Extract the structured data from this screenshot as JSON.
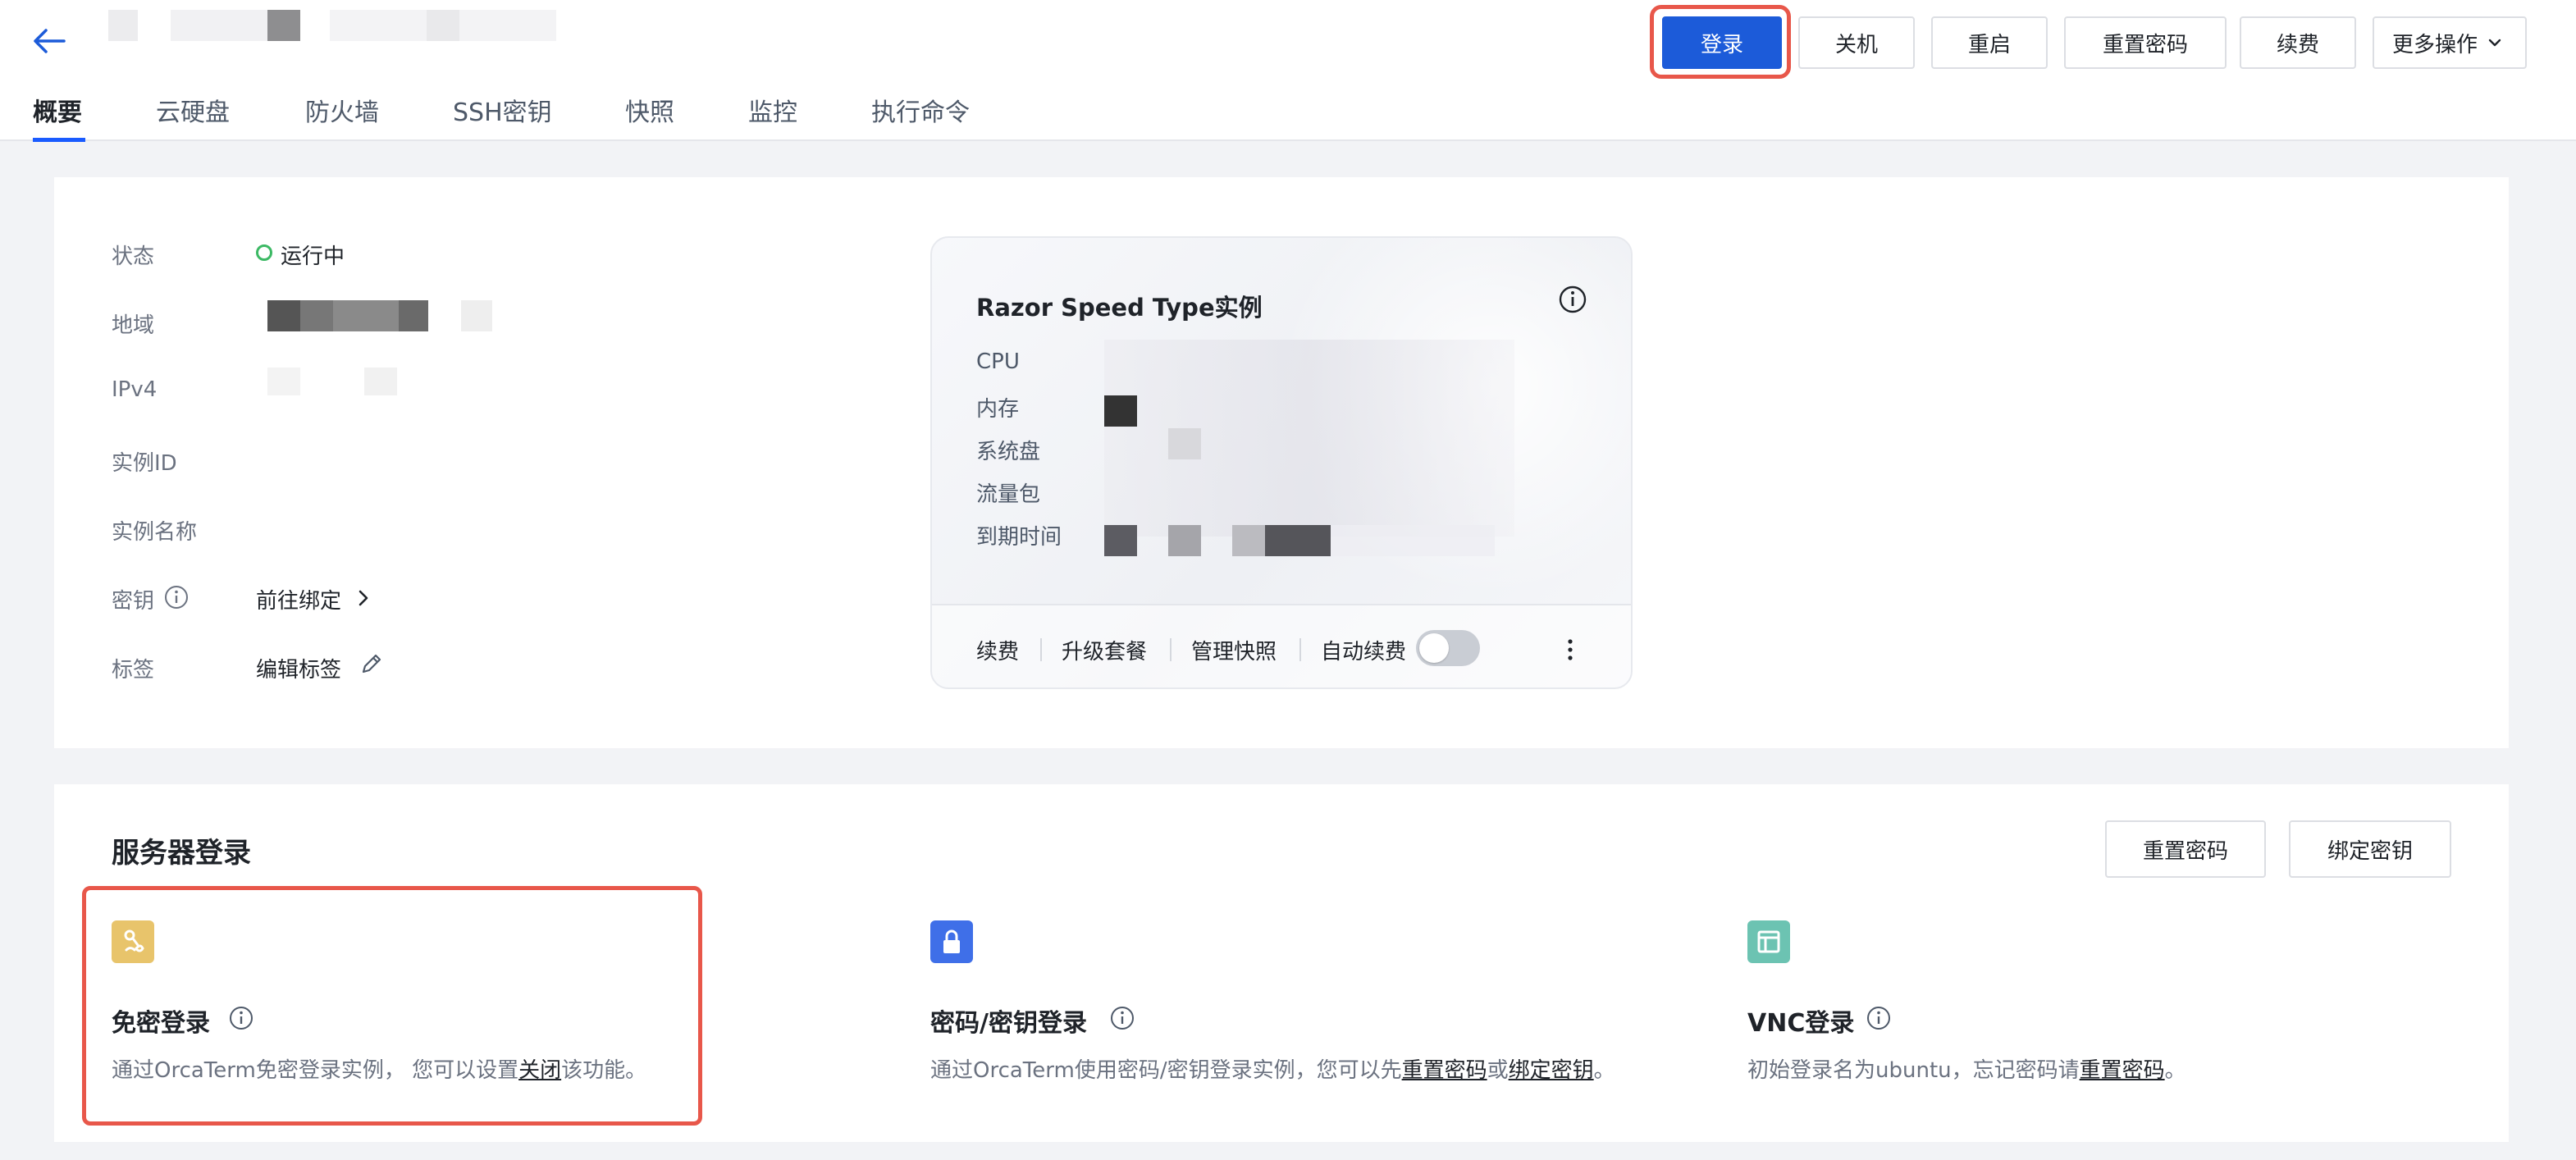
{
  "header": {
    "back_label": "←",
    "tabs": [
      {
        "label": "概要",
        "active": true
      },
      {
        "label": "云硬盘"
      },
      {
        "label": "防火墙"
      },
      {
        "label": "SSH密钥"
      },
      {
        "label": "快照"
      },
      {
        "label": "监控"
      },
      {
        "label": "执行命令"
      }
    ],
    "actions": {
      "login": "登录",
      "shutdown": "关机",
      "restart": "重启",
      "reset_password": "重置密码",
      "renew": "续费",
      "more": "更多操作"
    }
  },
  "overview": {
    "status_label": "状态",
    "status_value": "运行中",
    "status_color": "#3cb964",
    "region_label": "地域",
    "ipv4_label": "IPv4",
    "instance_id_label": "实例ID",
    "instance_name_label": "实例名称",
    "key_label": "密钥",
    "key_action": "前往绑定",
    "tag_label": "标签",
    "tag_action": "编辑标签"
  },
  "spec_card": {
    "title": "Razor Speed Type实例",
    "rows": [
      "CPU",
      "内存",
      "系统盘",
      "流量包",
      "到期时间"
    ],
    "footer": {
      "renew": "续费",
      "upgrade": "升级套餐",
      "manage_snapshot": "管理快照",
      "auto_renew": "自动续费",
      "auto_renew_on": false
    }
  },
  "server_login": {
    "title": "服务器登录",
    "reset_password": "重置密码",
    "bind_key": "绑定密钥",
    "methods": {
      "passwordless": {
        "title": "免密登录",
        "desc_prefix": "通过OrcaTerm免密登录实例， 您可以设置",
        "desc_link": "关闭",
        "desc_suffix": "该功能。",
        "icon_color": "#e8c46b"
      },
      "password_key": {
        "title": "密码/密钥登录",
        "desc_prefix": "通过OrcaTerm使用密码/密钥登录实例，您可以先",
        "desc_link1": "重置密码",
        "desc_mid": "或",
        "desc_link2": "绑定密钥",
        "desc_suffix": "。",
        "icon_color": "#3f6fe8"
      },
      "vnc": {
        "title": "VNC登录",
        "desc_prefix": "初始登录名为ubuntu，忘记密码请",
        "desc_link": "重置密码",
        "desc_suffix": "。",
        "icon_color": "#6cc3b2"
      }
    }
  },
  "colors": {
    "primary": "#1c5bd9",
    "highlight": "#e8574a",
    "tab_underline": "#1a5bff"
  }
}
